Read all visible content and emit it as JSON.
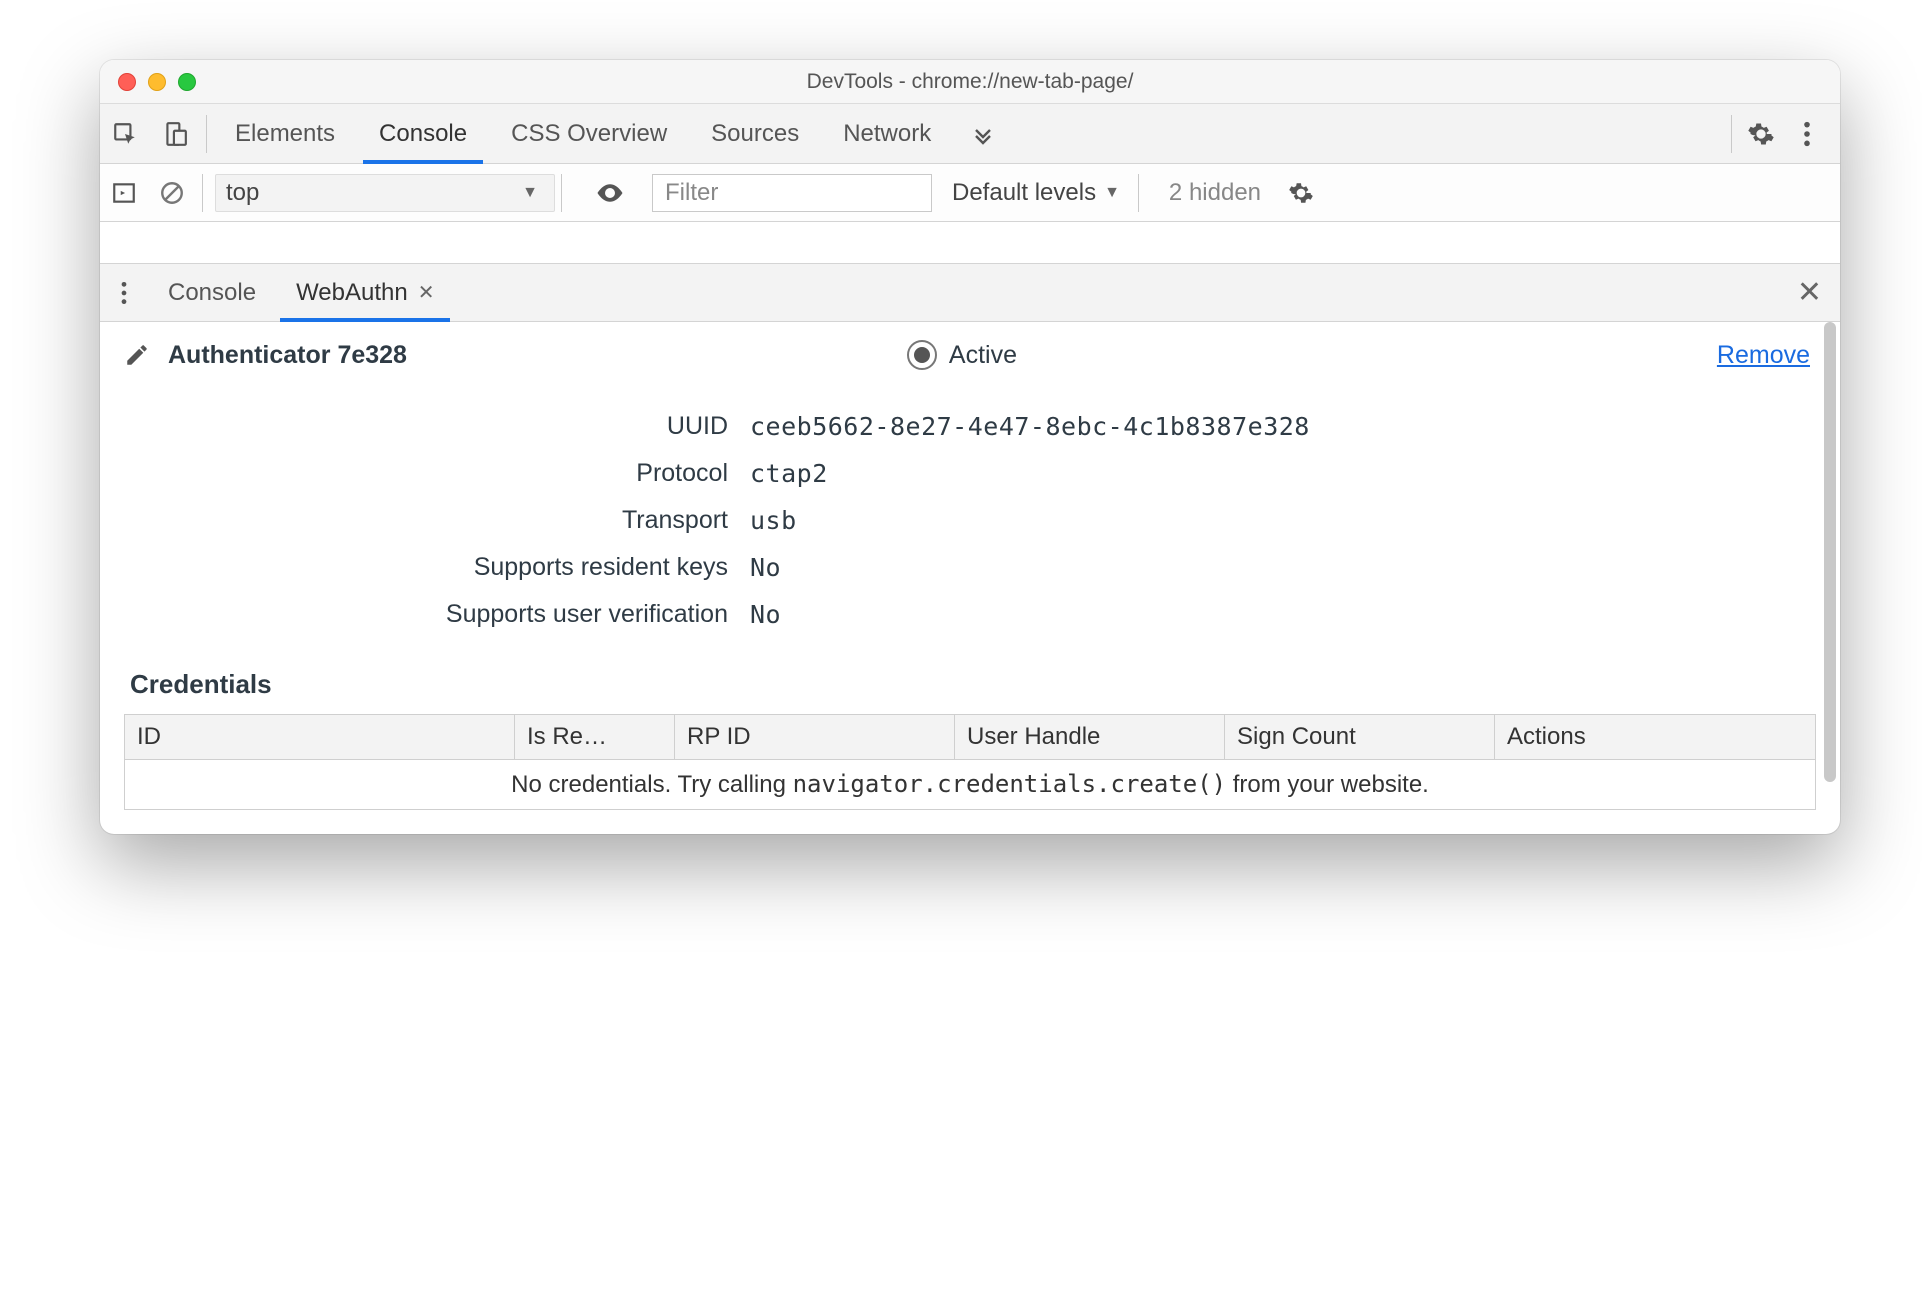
{
  "window": {
    "title": "DevTools - chrome://new-tab-page/"
  },
  "mainTabs": {
    "items": [
      "Elements",
      "Console",
      "CSS Overview",
      "Sources",
      "Network"
    ],
    "activeIndex": 1
  },
  "consoleBar": {
    "contextLabel": "top",
    "filterPlaceholder": "Filter",
    "levelsLabel": "Default levels",
    "hiddenLabel": "2 hidden"
  },
  "drawerTabs": {
    "items": [
      "Console",
      "WebAuthn"
    ],
    "activeIndex": 1
  },
  "authenticator": {
    "title": "Authenticator 7e328",
    "activeLabel": "Active",
    "removeLabel": "Remove",
    "fields": {
      "uuid_label": "UUID",
      "uuid_value": "ceeb5662-8e27-4e47-8ebc-4c1b8387e328",
      "protocol_label": "Protocol",
      "protocol_value": "ctap2",
      "transport_label": "Transport",
      "transport_value": "usb",
      "resident_label": "Supports resident keys",
      "resident_value": "No",
      "userverif_label": "Supports user verification",
      "userverif_value": "No"
    }
  },
  "credentials": {
    "heading": "Credentials",
    "columns": {
      "id": "ID",
      "isRe": "Is Re…",
      "rpId": "RP ID",
      "userHandle": "User Handle",
      "signCount": "Sign Count",
      "actions": "Actions"
    },
    "emptyPrefix": "No credentials. Try calling ",
    "emptyCode": "navigator.credentials.create()",
    "emptySuffix": " from your website."
  }
}
